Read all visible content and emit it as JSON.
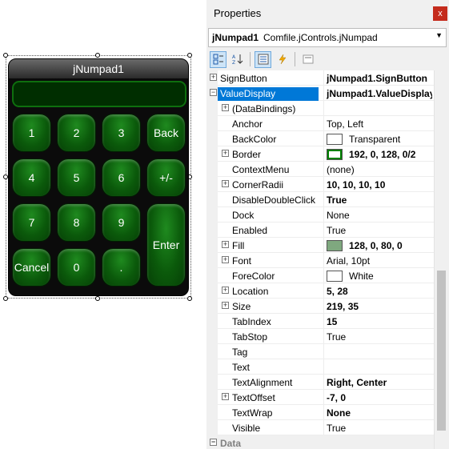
{
  "numpad": {
    "title": "jNumpad1",
    "keys": {
      "k1": "1",
      "k2": "2",
      "k3": "3",
      "back": "Back",
      "k4": "4",
      "k5": "5",
      "k6": "6",
      "sign": "+/-",
      "k7": "7",
      "k8": "8",
      "k9": "9",
      "enter": "Enter",
      "cancel": "Cancel",
      "k0": "0",
      "dot": "."
    },
    "colors": {
      "key_fill": "#0b5a0b",
      "display_fill": "#002e00",
      "display_border": "#0e6e0e"
    }
  },
  "properties": {
    "title": "Properties",
    "close_glyph": "x",
    "object_name": "jNumpad1",
    "object_type": "Comfile.jControls.jNumpad",
    "toolbar": {
      "categorized_icon": "categorized-icon",
      "alphabetical_icon": "alphabetical-icon",
      "properties_icon": "properties-icon",
      "events_icon": "events-icon",
      "pages_icon": "property-pages-icon"
    },
    "rows": [
      {
        "name": "SignButton",
        "value": "jNumpad1.SignButton",
        "bold": true,
        "expand": "+",
        "level": 0
      },
      {
        "name": "ValueDisplay",
        "value": "jNumpad1.ValueDisplay",
        "bold": true,
        "expand": "−",
        "level": 0,
        "selected": true
      },
      {
        "name": "(DataBindings)",
        "value": "",
        "expand": "+",
        "level": 1
      },
      {
        "name": "Anchor",
        "value": "Top, Left",
        "level": 1
      },
      {
        "name": "BackColor",
        "value": "Transparent",
        "level": 1,
        "swatch": "#ffffff"
      },
      {
        "name": "Border",
        "value": "192, 0, 128, 0/2",
        "bold": true,
        "expand": "+",
        "level": 1,
        "swatch": "#ffffff",
        "swatch_border": "#008000"
      },
      {
        "name": "ContextMenu",
        "value": "(none)",
        "level": 1
      },
      {
        "name": "CornerRadii",
        "value": "10, 10, 10, 10",
        "bold": true,
        "expand": "+",
        "level": 1
      },
      {
        "name": "DisableDoubleClick",
        "value": "True",
        "bold": true,
        "level": 1
      },
      {
        "name": "Dock",
        "value": "None",
        "level": 1
      },
      {
        "name": "Enabled",
        "value": "True",
        "level": 1
      },
      {
        "name": "Fill",
        "value": "128, 0, 80, 0",
        "bold": true,
        "expand": "+",
        "level": 1,
        "swatch": "#7fa87f"
      },
      {
        "name": "Font",
        "value": "Arial, 10pt",
        "expand": "+",
        "level": 1
      },
      {
        "name": "ForeColor",
        "value": "White",
        "level": 1,
        "swatch": "#ffffff"
      },
      {
        "name": "Location",
        "value": "5, 28",
        "bold": true,
        "expand": "+",
        "level": 1
      },
      {
        "name": "Size",
        "value": "219, 35",
        "bold": true,
        "expand": "+",
        "level": 1
      },
      {
        "name": "TabIndex",
        "value": "15",
        "bold": true,
        "level": 1
      },
      {
        "name": "TabStop",
        "value": "True",
        "level": 1
      },
      {
        "name": "Tag",
        "value": "",
        "level": 1
      },
      {
        "name": "Text",
        "value": "",
        "level": 1
      },
      {
        "name": "TextAlignment",
        "value": "Right, Center",
        "bold": true,
        "level": 1
      },
      {
        "name": "TextOffset",
        "value": "-7, 0",
        "bold": true,
        "expand": "+",
        "level": 1
      },
      {
        "name": "TextWrap",
        "value": "None",
        "bold": true,
        "level": 1
      },
      {
        "name": "Visible",
        "value": "True",
        "level": 1
      },
      {
        "name": "Data",
        "value": "",
        "expand": "−",
        "level": 0,
        "category": true
      }
    ]
  }
}
